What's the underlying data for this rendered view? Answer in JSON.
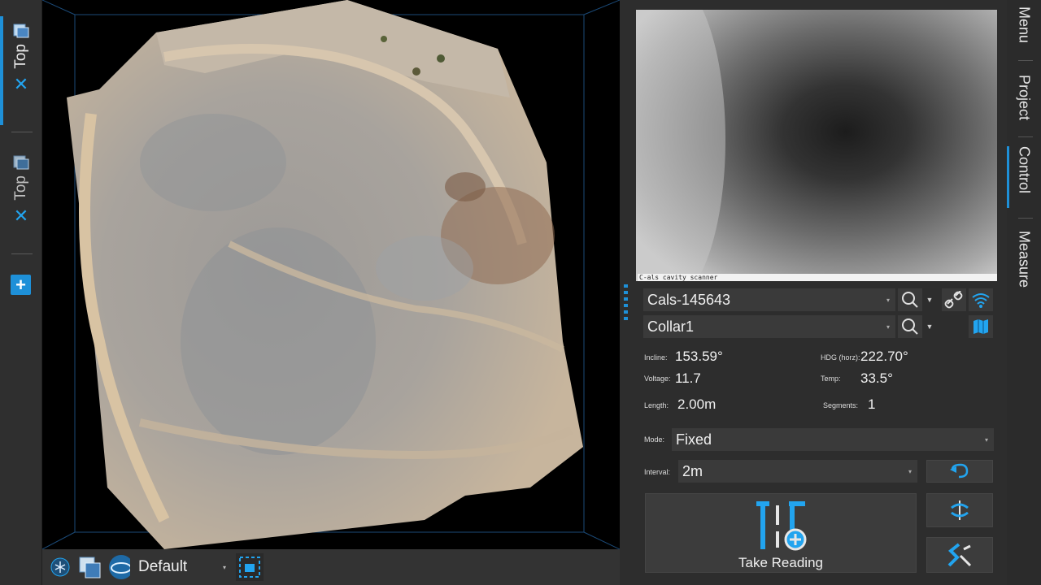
{
  "left_tabs": [
    {
      "label": "Top",
      "active": true,
      "close": "✕"
    },
    {
      "label": "Top",
      "active": false,
      "close": "✕"
    }
  ],
  "add_view": "+",
  "viewport_bar": {
    "layout_label": "Default"
  },
  "camera": {
    "caption": "C-als cavity scanner"
  },
  "device": {
    "scanner": "Cals-145643",
    "collar": "Collar1"
  },
  "readings": {
    "incline_label": "Incline:",
    "incline_value": "153.59°",
    "hdg_label": "HDG (horz):",
    "hdg_value": "222.70°",
    "voltage_label": "Voltage:",
    "voltage_value": "11.7",
    "temp_label": "Temp:",
    "temp_value": "33.5°",
    "length_label": "Length:",
    "length_value": "2.00m",
    "segments_label": "Segments:",
    "segments_value": "1"
  },
  "mode": {
    "label": "Mode:",
    "value": "Fixed"
  },
  "interval": {
    "label": "Interval:",
    "value": "2m"
  },
  "take_reading_label": "Take Reading",
  "right_tabs": [
    "Menu",
    "Project",
    "Control",
    "Measure"
  ],
  "colors": {
    "accent": "#1e90d8",
    "icon": "#22a4ef"
  }
}
